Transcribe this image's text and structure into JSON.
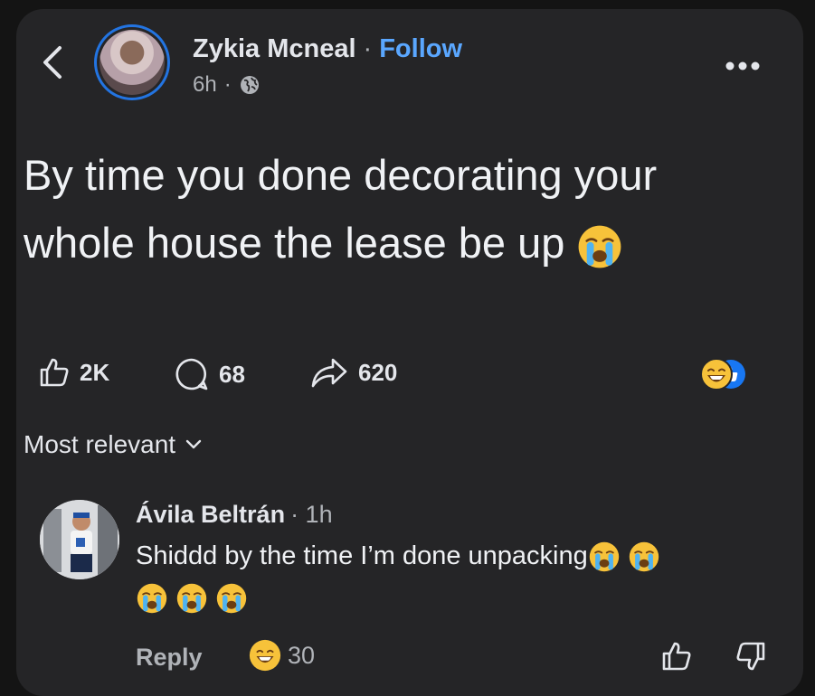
{
  "post": {
    "author": "Zykia Mcneal",
    "separator": "·",
    "follow_label": "Follow",
    "time": "6h",
    "meta_sep": "·",
    "text": "By time you done decorating your whole house the lease be up",
    "text_emoji": "crying-face-emoji"
  },
  "actions": {
    "likes": "2K",
    "comments": "68",
    "shares": "620",
    "reactions": [
      "grinning-face-emoji",
      "like-emoji"
    ]
  },
  "comments_section": {
    "sort_label": "Most relevant"
  },
  "comment": {
    "author": "Ávila Beltrán",
    "time": "· 1h",
    "text": "Shiddd by the time I’m done unpacking",
    "emojis": [
      "crying-face-emoji",
      "crying-face-emoji",
      "crying-face-emoji",
      "crying-face-emoji",
      "crying-face-emoji"
    ],
    "reply_label": "Reply",
    "reaction_count": "30"
  },
  "colors": {
    "background": "#141414",
    "card": "#252527",
    "accent": "#5aa7ff",
    "ring": "#2374e1",
    "text": "#e4e6eb",
    "muted": "#b0b3b8"
  }
}
